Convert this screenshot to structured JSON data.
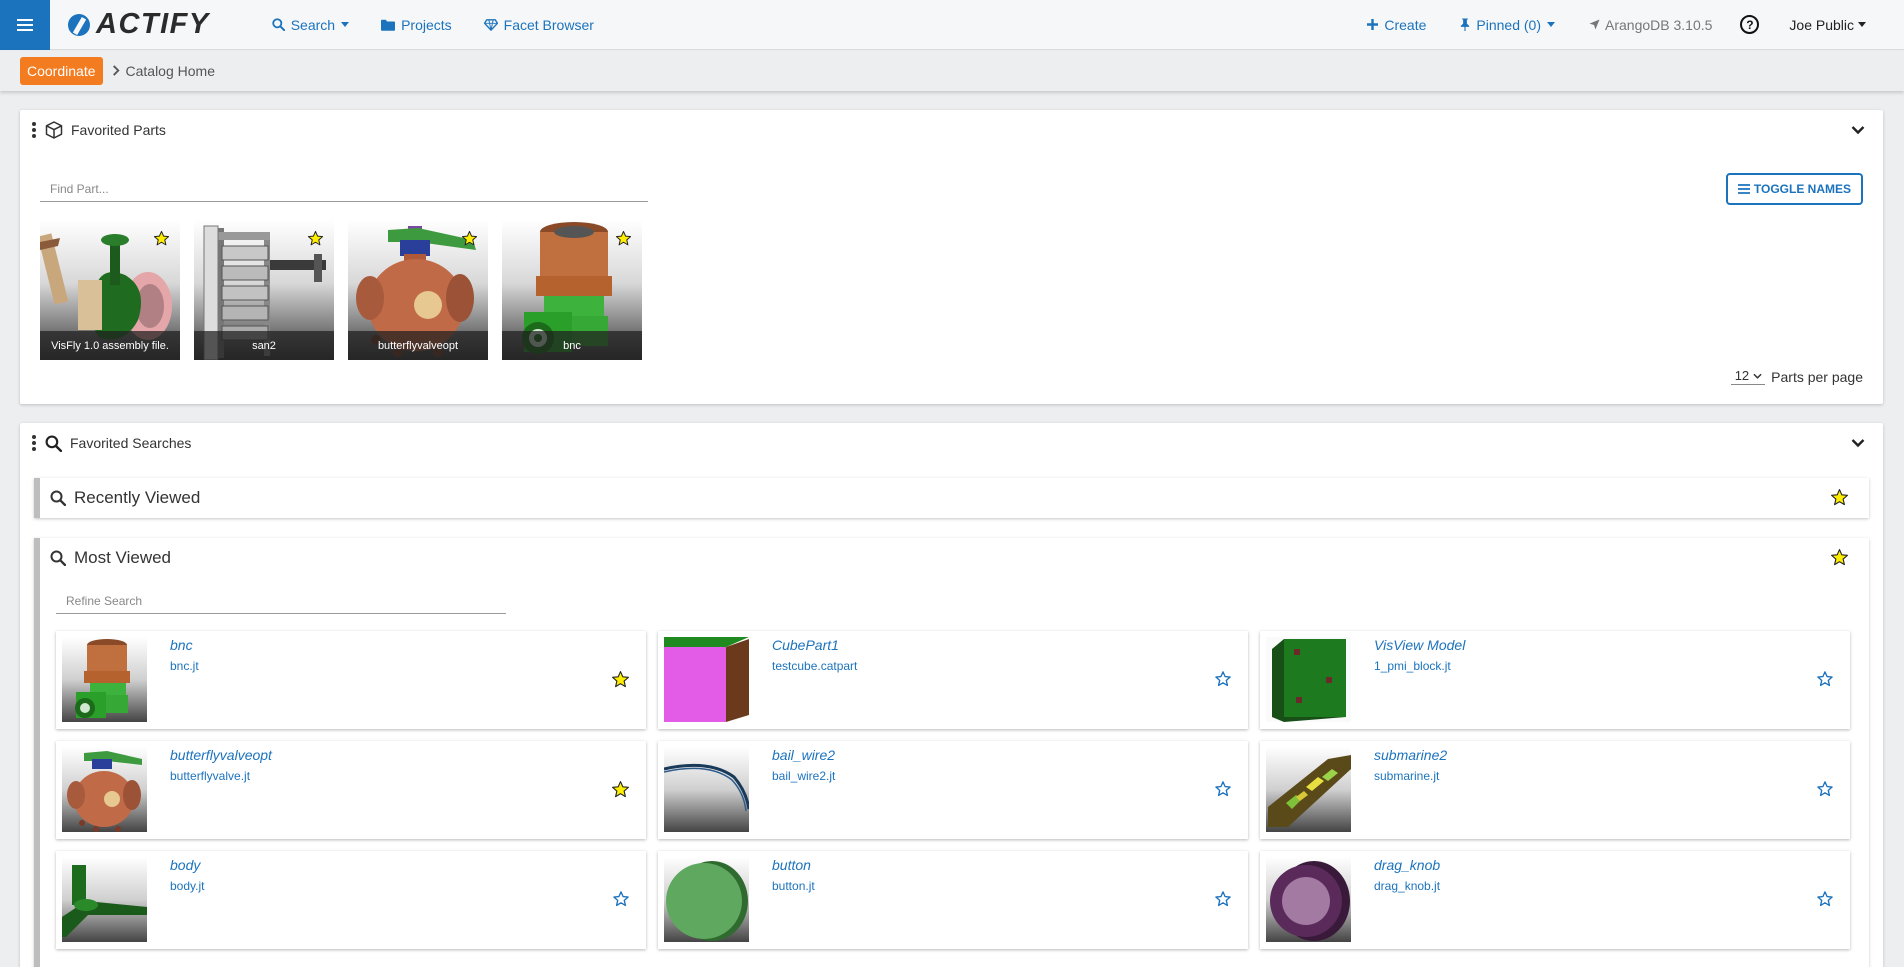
{
  "app": {
    "logo_text": "ACTIFY"
  },
  "nav": {
    "search": "Search",
    "projects": "Projects",
    "facet_browser": "Facet Browser",
    "create": "Create",
    "pinned": "Pinned (0)",
    "db_version": "ArangoDB 3.10.5",
    "help": "?",
    "user": "Joe Public"
  },
  "breadcrumb": {
    "badge": "Coordinate",
    "home": "Catalog Home"
  },
  "favorited_parts": {
    "title": "Favorited Parts",
    "find_placeholder": "Find Part...",
    "toggle_names": "TOGGLE NAMES",
    "per_page_value": "12",
    "per_page_label": "Parts per page",
    "items": [
      {
        "label": "VisFly 1.0 assembly file.",
        "icon": "assembly-thumbnail"
      },
      {
        "label": "san2",
        "icon": "rack-thumbnail"
      },
      {
        "label": "butterflyvalveopt",
        "icon": "valve-thumbnail"
      },
      {
        "label": "bnc",
        "icon": "connector-thumbnail"
      }
    ]
  },
  "favorited_searches": {
    "title": "Favorited Searches",
    "recently_viewed": {
      "title": "Recently Viewed"
    },
    "most_viewed": {
      "title": "Most Viewed",
      "refine_placeholder": "Refine Search",
      "cards": [
        {
          "name": "bnc",
          "file": "bnc.jt",
          "starred": true
        },
        {
          "name": "CubePart1",
          "file": "testcube.catpart",
          "starred": false
        },
        {
          "name": "VisView Model",
          "file": "1_pmi_block.jt",
          "starred": false
        },
        {
          "name": "butterflyvalveopt",
          "file": "butterflyvalve.jt",
          "starred": true
        },
        {
          "name": "bail_wire2",
          "file": "bail_wire2.jt",
          "starred": false
        },
        {
          "name": "submarine2",
          "file": "submarine.jt",
          "starred": false
        },
        {
          "name": "body",
          "file": "body.jt",
          "starred": false
        },
        {
          "name": "button",
          "file": "button.jt",
          "starred": false
        },
        {
          "name": "drag_knob",
          "file": "drag_knob.jt",
          "starred": false
        }
      ]
    }
  },
  "colors": {
    "accent": "#1c73bd",
    "badge": "#f47c20",
    "star": "#ffee00"
  }
}
